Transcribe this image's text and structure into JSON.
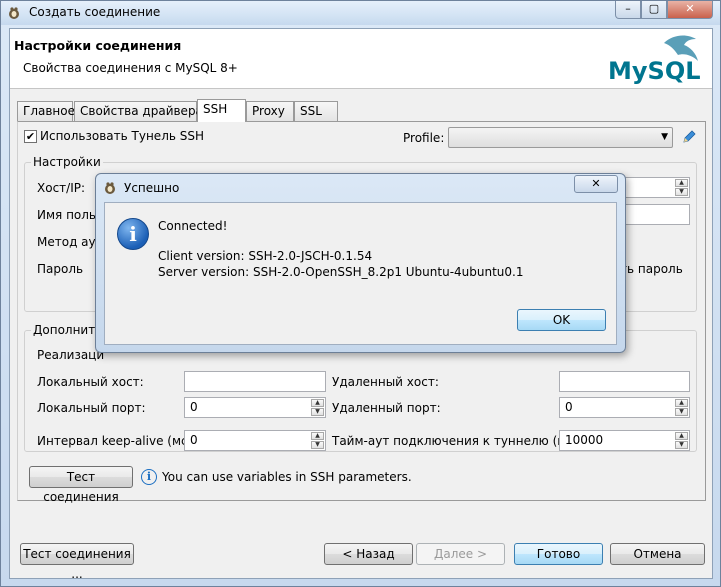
{
  "window": {
    "title": "Создать соединение",
    "header_title": "Настройки соединения",
    "header_subtitle": "Свойства соединения с MySQL 8+",
    "logo_text": "MySQL"
  },
  "tabs": [
    {
      "label": "Главное"
    },
    {
      "label": "Свойства драйвера"
    },
    {
      "label": "SSH",
      "active": true
    },
    {
      "label": "Proxy"
    },
    {
      "label": "SSL"
    }
  ],
  "ssh": {
    "use_tunnel_label": "Использовать Тунель SSH",
    "use_tunnel_checked": true,
    "profile_label": "Profile:",
    "profile_value": "",
    "settings_group": "Настройки",
    "host_label": "Хост/IP:",
    "user_label": "Имя польз",
    "auth_label": "Метод ауте",
    "password_label": "Пароль",
    "save_password_label": "ть пароль",
    "advanced_group": "Дополните",
    "impl_label": "Реализаци",
    "local_host_label": "Локальный хост:",
    "remote_host_label": "Удаленный хост:",
    "local_port_label": "Локальный порт:",
    "local_port_value": "0",
    "remote_port_label": "Удаленный порт:",
    "remote_port_value": "0",
    "keepalive_label": "Интервал keep-alive (мс):",
    "keepalive_value": "0",
    "tunnel_timeout_label": "Тайм-аут подключения к туннелю (мс):",
    "tunnel_timeout_value": "10000",
    "test_button": "Тест соединения",
    "hint": "You can use variables in SSH parameters."
  },
  "footer": {
    "test_button": "Тест соединения ...",
    "back_button": "< Назад",
    "next_button": "Далее >",
    "finish_button": "Готово",
    "cancel_button": "Отмена"
  },
  "dialog": {
    "title": "Успешно",
    "message": "Connected!",
    "client_version": "Client version: SSH-2.0-JSCH-0.1.54",
    "server_version": "Server version: SSH-2.0-OpenSSH_8.2p1 Ubuntu-4ubuntu0.1",
    "ok_button": "OK"
  },
  "colors": {
    "accent": "#3c7fb1",
    "mysql_blue": "#00758f",
    "mysql_orange": "#f29111"
  }
}
